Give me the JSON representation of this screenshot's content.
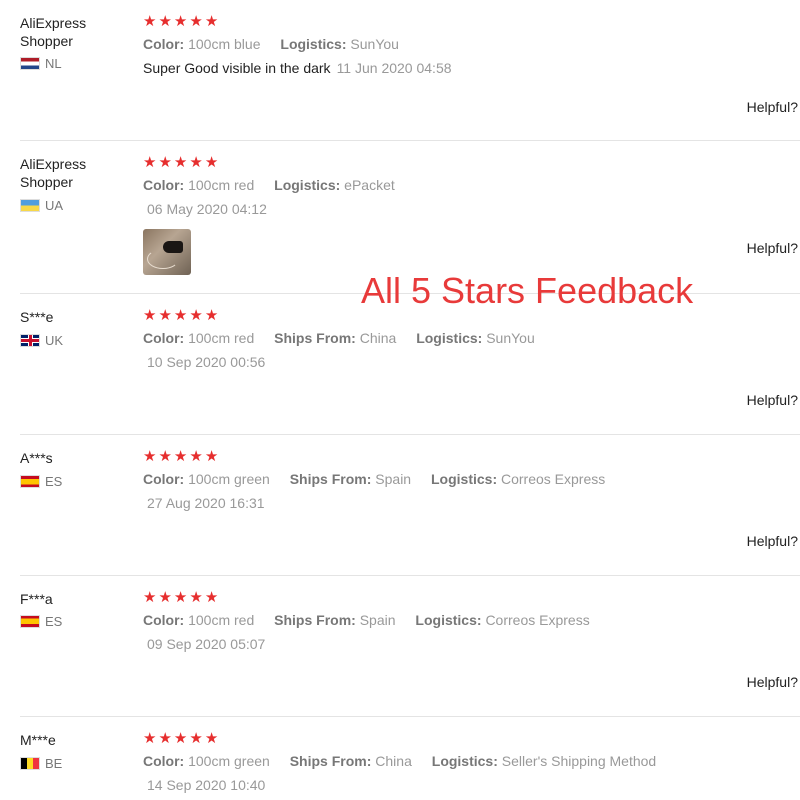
{
  "overlay": {
    "text": "All 5 Stars Feedback"
  },
  "colors": {
    "star": "#e62e2e",
    "overlay": "#e83a3a"
  },
  "helpful_label": "Helpful?",
  "reviews": [
    {
      "user": "AliExpress Shopper",
      "country": "NL",
      "flag": "flag-nl-icon",
      "rating": 5,
      "attributes": [
        {
          "key": "Color:",
          "value": "100cm blue"
        },
        {
          "key": "Logistics:",
          "value": "SunYou"
        }
      ],
      "text": "Super Good visible in the dark",
      "date": "11 Jun 2020 04:58"
    },
    {
      "user": "AliExpress Shopper",
      "country": "UA",
      "flag": "flag-ua-icon",
      "rating": 5,
      "attributes": [
        {
          "key": "Color:",
          "value": "100cm red"
        },
        {
          "key": "Logistics:",
          "value": "ePacket"
        }
      ],
      "date": "06 May 2020 04:12",
      "has_photo": true
    },
    {
      "user": "S***e",
      "country": "UK",
      "flag": "flag-uk-icon",
      "rating": 5,
      "attributes": [
        {
          "key": "Color:",
          "value": "100cm red"
        },
        {
          "key": "Ships From:",
          "value": "China"
        },
        {
          "key": "Logistics:",
          "value": "SunYou"
        }
      ],
      "date": "10 Sep 2020 00:56"
    },
    {
      "user": "A***s",
      "country": "ES",
      "flag": "flag-es-icon",
      "rating": 5,
      "attributes": [
        {
          "key": "Color:",
          "value": "100cm green"
        },
        {
          "key": "Ships From:",
          "value": "Spain"
        },
        {
          "key": "Logistics:",
          "value": "Correos Express"
        }
      ],
      "date": "27 Aug 2020 16:31"
    },
    {
      "user": "F***a",
      "country": "ES",
      "flag": "flag-es-icon",
      "rating": 5,
      "attributes": [
        {
          "key": "Color:",
          "value": "100cm red"
        },
        {
          "key": "Ships From:",
          "value": "Spain"
        },
        {
          "key": "Logistics:",
          "value": "Correos Express"
        }
      ],
      "date": "09 Sep 2020 05:07"
    },
    {
      "user": "M***e",
      "country": "BE",
      "flag": "flag-be-icon",
      "rating": 5,
      "attributes": [
        {
          "key": "Color:",
          "value": "100cm green"
        },
        {
          "key": "Ships From:",
          "value": "China"
        },
        {
          "key": "Logistics:",
          "value": "Seller's Shipping Method"
        }
      ],
      "date": "14 Sep 2020 10:40"
    }
  ]
}
